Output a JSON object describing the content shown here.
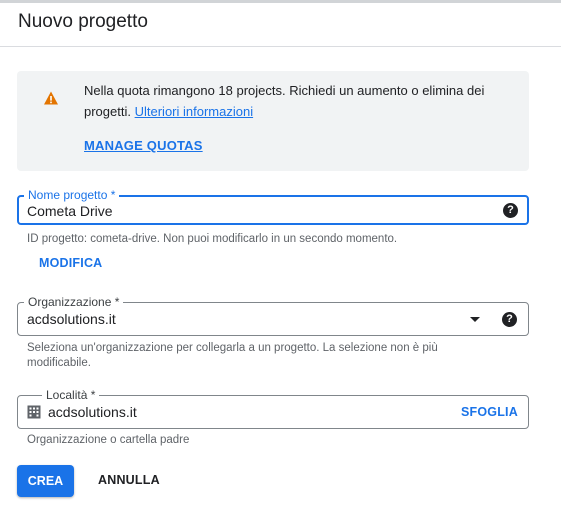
{
  "dialog": {
    "title": "Nuovo progetto"
  },
  "quota": {
    "message": "Nella quota rimangono 18 projects. Richiedi un aumento o elimina dei progetti.",
    "link": "Ulteriori informazioni",
    "manage": "MANAGE QUOTAS",
    "icon": "warning-icon",
    "icon_color": "#e37400"
  },
  "project_name": {
    "label": "Nome progetto *",
    "value": "Cometa Drive",
    "hint": "ID progetto: cometa-drive. Non puoi modificarlo in un secondo momento.",
    "modify": "MODIFICA"
  },
  "organization": {
    "label": "Organizzazione *",
    "value": "acdsolutions.it",
    "hint_line1": "Seleziona un'organizzazione per collegarla a un progetto. La selezione non è più",
    "hint_line2": "modificabile."
  },
  "location": {
    "label": "Località *",
    "value": "acdsolutions.it",
    "browse": "SFOGLIA",
    "hint": "Organizzazione o cartella padre"
  },
  "actions": {
    "create": "CREA",
    "cancel": "ANNULLA"
  },
  "colors": {
    "accent": "#1a73e8",
    "panel": "#f1f3f4"
  }
}
